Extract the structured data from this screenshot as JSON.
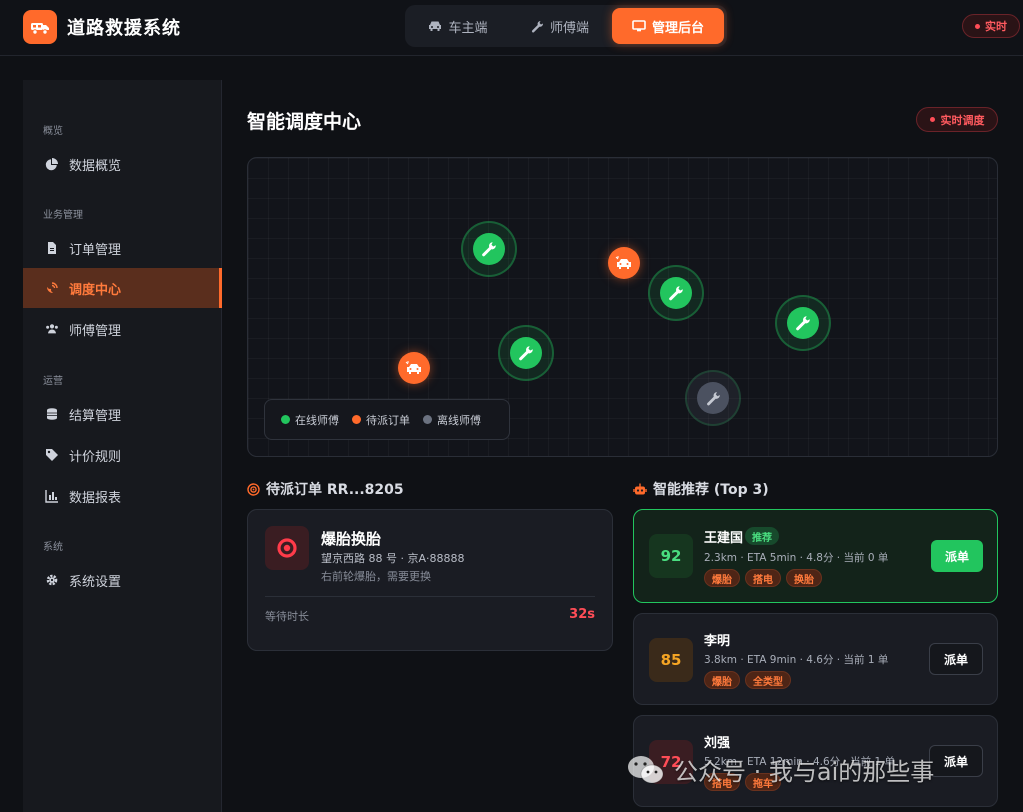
{
  "header": {
    "brand": "道路救援系统",
    "tabs": [
      {
        "label": "车主端",
        "icon": "car-icon"
      },
      {
        "label": "师傅端",
        "icon": "wrench-icon"
      },
      {
        "label": "管理后台",
        "icon": "monitor-icon",
        "active": true
      }
    ],
    "live_label": "实时"
  },
  "sidebar": {
    "sections": [
      "概览",
      "业务管理",
      "运营",
      "系统"
    ],
    "items": [
      {
        "label": "数据概览",
        "icon": "pie-chart-icon"
      },
      {
        "label": "订单管理",
        "icon": "document-icon"
      },
      {
        "label": "调度中心",
        "icon": "satellite-dish-icon",
        "active": true
      },
      {
        "label": "师傅管理",
        "icon": "users-icon"
      },
      {
        "label": "结算管理",
        "icon": "coins-icon"
      },
      {
        "label": "计价规则",
        "icon": "tag-icon"
      },
      {
        "label": "数据报表",
        "icon": "bar-chart-icon"
      },
      {
        "label": "系统设置",
        "icon": "gear-icon"
      }
    ]
  },
  "main": {
    "title": "智能调度中心",
    "live_label": "实时调度",
    "map": {
      "legend": [
        "在线师傅",
        "待派订单",
        "离线师傅"
      ]
    },
    "pending": {
      "header": "待派订单 RR...8205",
      "title": "爆胎换胎",
      "address": "望京西路 88 号 · 京A·88888",
      "description": "右前轮爆胎，需要更换",
      "wait_label": "等待时长",
      "wait_value": "32s"
    },
    "recommend": {
      "header": "智能推荐 (Top 3)",
      "badge": "推荐",
      "items": [
        {
          "score": "92",
          "name": "王建国",
          "meta": "2.3km · ETA 5min · 4.8分 · 当前 0 单",
          "tags": [
            "爆胎",
            "搭电",
            "换胎"
          ],
          "button": "派单"
        },
        {
          "score": "85",
          "name": "李明",
          "meta": "3.8km · ETA 9min · 4.6分 · 当前 1 单",
          "tags": [
            "爆胎",
            "全类型"
          ],
          "button": "派单"
        },
        {
          "score": "72",
          "name": "刘强",
          "meta": "5.2km · ETA 12min · 4.6分 · 当前 1 单",
          "tags": [
            "搭电",
            "拖车"
          ],
          "button": "派单"
        }
      ]
    }
  },
  "watermark": "公众号 · 我与ai的那些事",
  "colors": {
    "accent": "#ff6a2b",
    "online": "#22c55e",
    "offline": "#4b5160",
    "danger": "#ff4d57"
  }
}
